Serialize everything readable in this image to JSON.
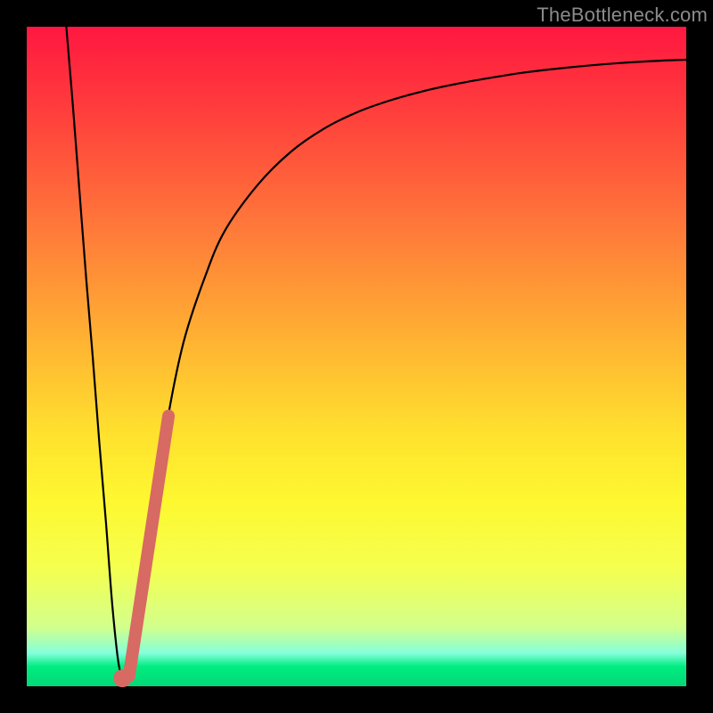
{
  "watermark": {
    "text": "TheBottleneck.com"
  },
  "chart_data": {
    "type": "line",
    "title": "",
    "xlabel": "",
    "ylabel": "",
    "xlim": [
      0,
      100
    ],
    "ylim": [
      0,
      100
    ],
    "grid": false,
    "legend": false,
    "series": [
      {
        "name": "bottleneck-curve",
        "x": [
          6,
          7,
          8,
          9,
          10,
          11,
          12,
          13,
          14,
          15,
          16,
          17,
          18,
          20,
          22,
          24,
          27,
          30,
          35,
          40,
          45,
          50,
          55,
          60,
          65,
          70,
          75,
          80,
          85,
          90,
          95,
          100
        ],
        "y": [
          100,
          88,
          75,
          62,
          50,
          37,
          25,
          12,
          3,
          1,
          3,
          10,
          18,
          32,
          44,
          53,
          62,
          69,
          76,
          81,
          84.5,
          87,
          88.8,
          90.2,
          91.3,
          92.2,
          93,
          93.6,
          94.1,
          94.5,
          94.8,
          95
        ]
      },
      {
        "name": "highlight-segment",
        "x": [
          15.5,
          21.5
        ],
        "y": [
          1.5,
          41
        ],
        "stroke": "#d76a63",
        "stroke_width": 14
      },
      {
        "name": "highlight-dot",
        "x": [
          14.5
        ],
        "y": [
          1.2
        ],
        "marker": "circle",
        "color": "#d76a63",
        "radius": 10
      }
    ],
    "background_gradient": {
      "direction": "vertical",
      "stops": [
        {
          "pos": 0.0,
          "color": "#ff1740"
        },
        {
          "pos": 0.15,
          "color": "#ff453c"
        },
        {
          "pos": 0.32,
          "color": "#ff7e39"
        },
        {
          "pos": 0.48,
          "color": "#ffb432"
        },
        {
          "pos": 0.62,
          "color": "#ffe22e"
        },
        {
          "pos": 0.72,
          "color": "#fdf830"
        },
        {
          "pos": 0.82,
          "color": "#f5ff4e"
        },
        {
          "pos": 0.91,
          "color": "#d3ff8c"
        },
        {
          "pos": 0.95,
          "color": "#84ffdb"
        },
        {
          "pos": 0.97,
          "color": "#00ed80"
        },
        {
          "pos": 1.0,
          "color": "#02d877"
        }
      ]
    }
  }
}
